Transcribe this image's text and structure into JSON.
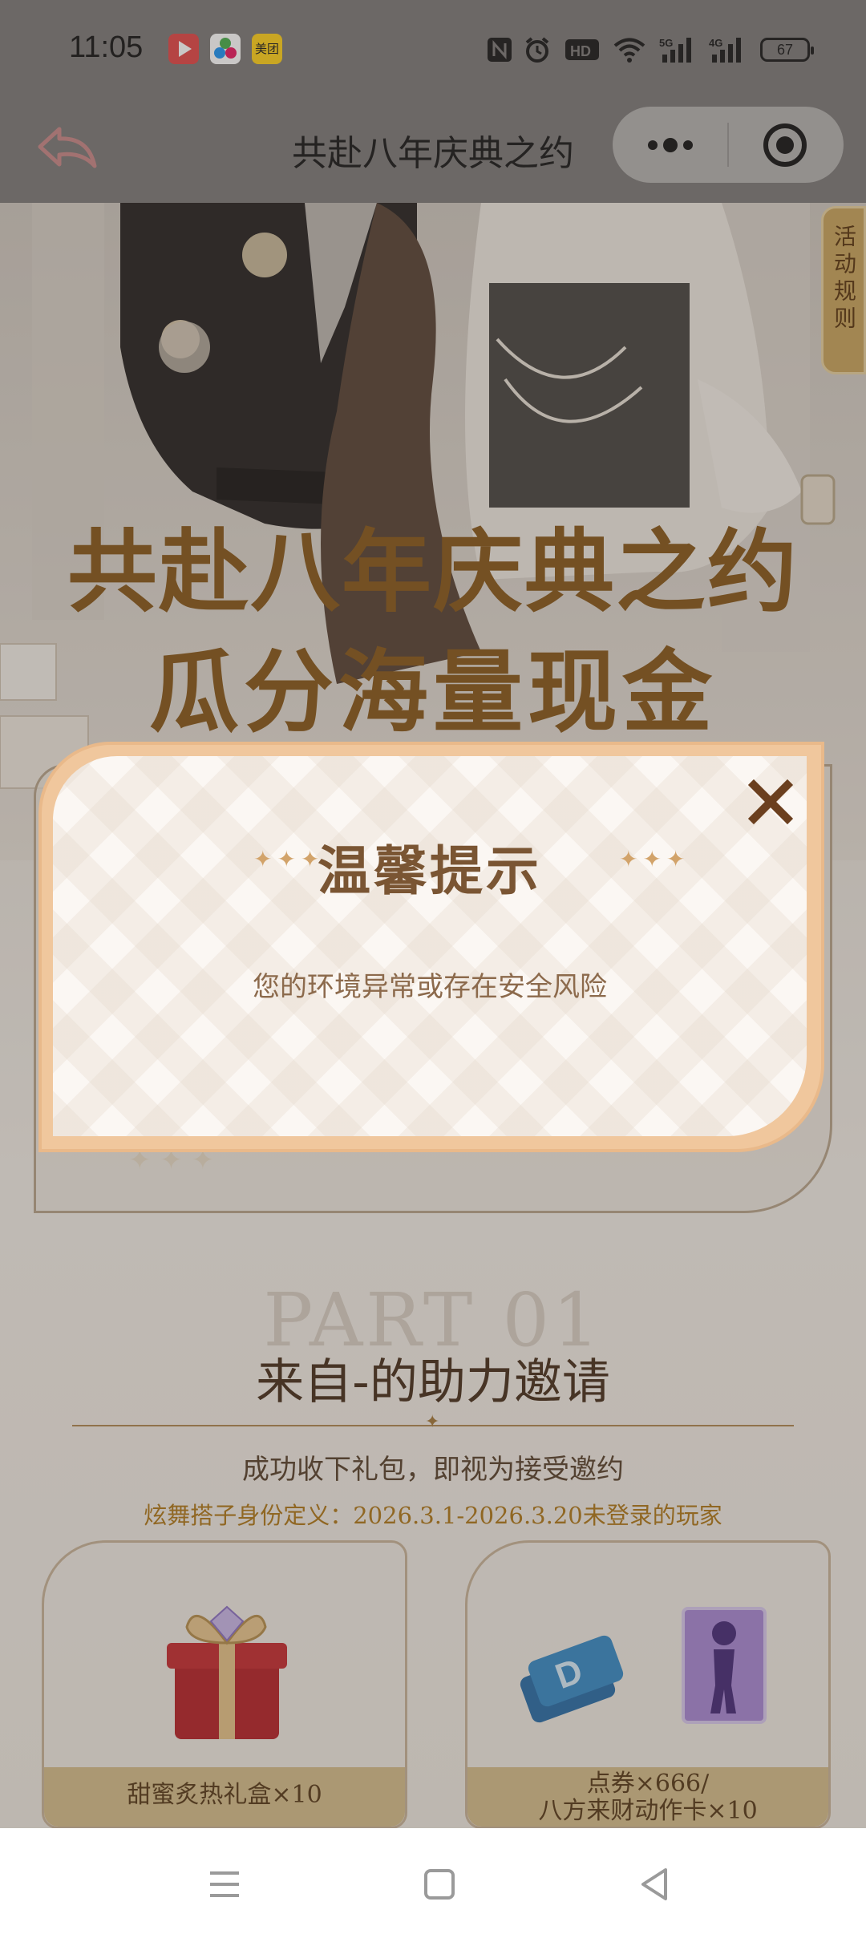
{
  "status_bar": {
    "time": "11:05",
    "app_icons": [
      "video-app-icon",
      "colorful-app-icon",
      "meituan-app-icon"
    ],
    "meituan_label": "美团",
    "indicators": [
      "nfc-icon",
      "alarm-icon",
      "hd-icon",
      "wifi-icon",
      "5g-signal-icon",
      "4g-signal-icon"
    ],
    "battery": "67"
  },
  "title_bar": {
    "title": "共赴八年庆典之约"
  },
  "hero": {
    "title_line1": "共赴八年庆典之约",
    "title_line2": "瓜分海量现金",
    "rules_tab": "活动规则"
  },
  "section": {
    "part_label": "PART 01",
    "title": "来自-的助力邀请",
    "subtitle": "成功收下礼包，即视为接受邀约",
    "definition": "炫舞搭子身份定义：2026.3.1-2026.3.20未登录的玩家"
  },
  "rewards": [
    {
      "caption": "甜蜜炙热礼盒×10"
    },
    {
      "caption_line1": "点券×666/",
      "caption_line2": "八方来财动作卡×10"
    }
  ],
  "modal": {
    "title": "温馨提示",
    "message": "您的环境异常或存在安全风险"
  },
  "colors": {
    "accent_gold": "#8a5b1e",
    "modal_border": "#f0c79d",
    "modal_title": "#7a5533"
  }
}
